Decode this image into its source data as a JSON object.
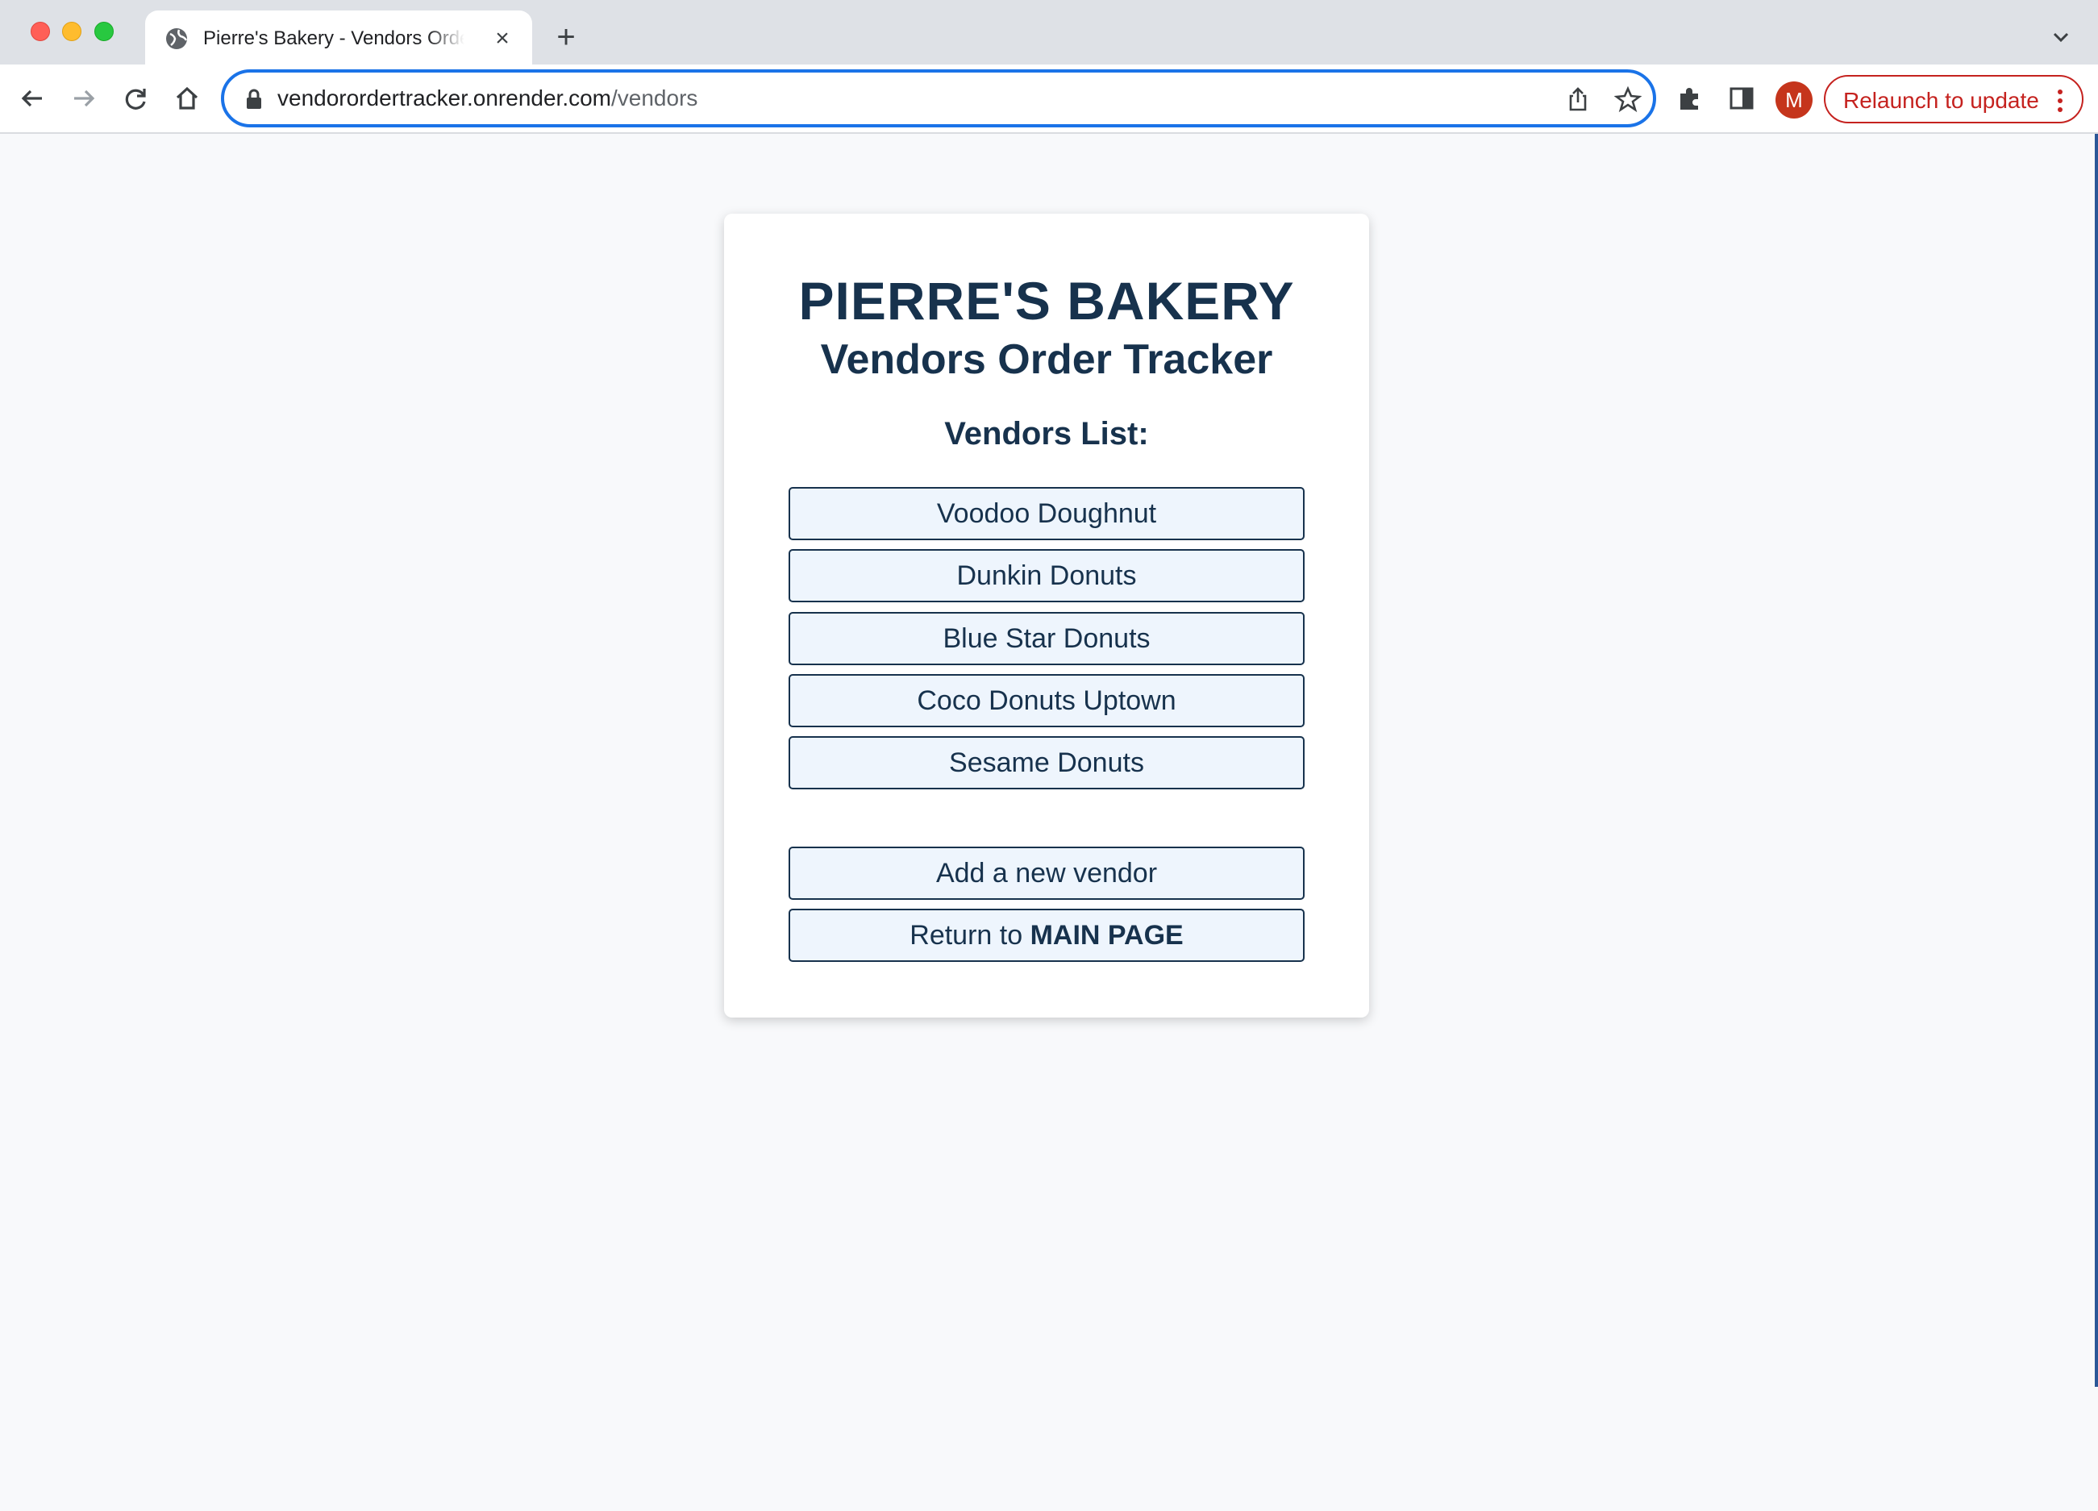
{
  "browser": {
    "tab_title": "Pierre's Bakery - Vendors Order Tracker",
    "tab_close": "×",
    "new_tab": "+",
    "url_host": "vendorordertracker.onrender.com",
    "url_path": "/vendors",
    "profile_initial": "M",
    "relaunch_label": "Relaunch to update",
    "colors": {
      "focus_ring": "#1a73e8",
      "relaunch": "#c5221f",
      "avatar": "#c5351c"
    }
  },
  "page": {
    "title": "PIERRE'S BAKERY",
    "subtitle": "Vendors Order Tracker",
    "list_heading": "Vendors List:",
    "vendors": [
      "Voodoo Doughnut",
      "Dunkin Donuts",
      "Blue Star Donuts",
      "Coco Donuts Uptown",
      "Sesame Donuts"
    ],
    "add_vendor_label": "Add a new vendor",
    "return_prefix": "Return to ",
    "return_emphasis": "MAIN PAGE",
    "colors": {
      "text": "#17324d",
      "button_bg": "#eef5fd",
      "page_bg": "#f8f9fb"
    }
  }
}
